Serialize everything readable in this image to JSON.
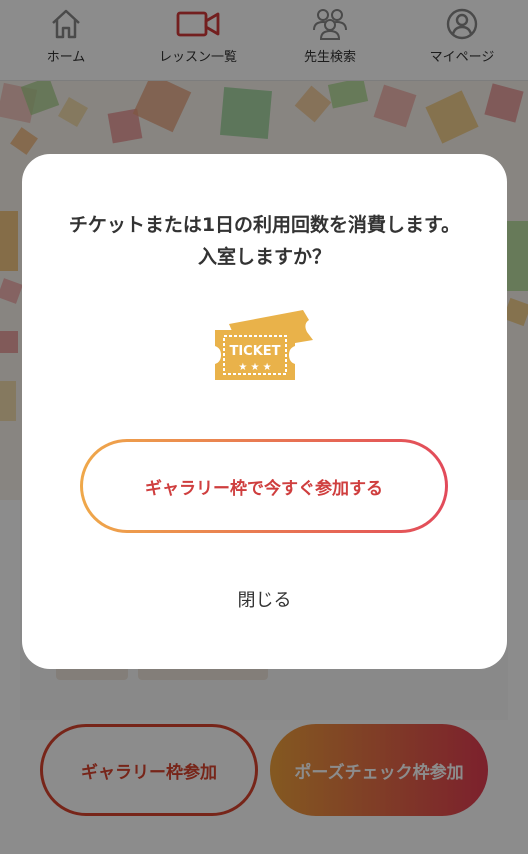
{
  "nav": {
    "items": [
      {
        "label": "ホーム",
        "icon": "home-icon"
      },
      {
        "label": "レッスン一覧",
        "icon": "video-camera-icon"
      },
      {
        "label": "先生検索",
        "icon": "group-icon"
      },
      {
        "label": "マイページ",
        "icon": "user-circle-icon"
      }
    ],
    "active_index": 1
  },
  "background": {
    "gallery_button": "ギャラリー枠参加",
    "pose_button": "ポーズチェック枠参加"
  },
  "modal": {
    "message_line1": "チケットまたは1日の利用回数を消費します。",
    "message_line2": "入室しますか？",
    "ticket_icon": "ticket-icon",
    "ticket_text": "TICKET",
    "primary_button": "ギャラリー枠で今すぐ参加する",
    "close_button": "閉じる"
  },
  "colors": {
    "accent_red": "#d9442f",
    "gradient_start": "#efa84a",
    "gradient_end": "#e24a5a",
    "ticket_gold": "#e9b24a"
  }
}
